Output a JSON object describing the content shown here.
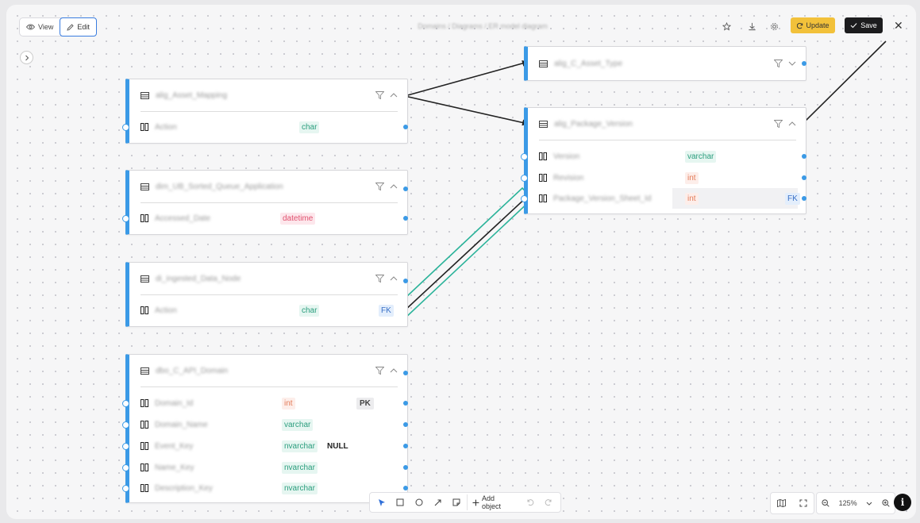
{
  "toolbar": {
    "view_label": "View",
    "edit_label": "Edit",
    "breadcrumb": "Domains / Diagrams / ER model diagram",
    "update_label": "Update",
    "save_label": "Save",
    "close_glyph": "✕"
  },
  "tables": [
    {
      "name": "alig_Asset_Mapping",
      "columns": [
        {
          "name": "Action",
          "type": "char"
        }
      ]
    },
    {
      "name": "dim_UB_Sorted_Queue_Application",
      "columns": [
        {
          "name": "Accessed_Date",
          "type": "datetime"
        }
      ]
    },
    {
      "name": "di_ingested_Data_Node",
      "columns": [
        {
          "name": "Action",
          "type": "char",
          "key": "FK"
        }
      ]
    },
    {
      "name": "dbo_C_API_Domain",
      "columns": [
        {
          "name": "Domain_Id",
          "type": "int",
          "key": "PK"
        },
        {
          "name": "Domain_Name",
          "type": "varchar"
        },
        {
          "name": "Event_Key",
          "type": "nvarchar",
          "nullable": "NULL"
        },
        {
          "name": "Name_Key",
          "type": "nvarchar"
        },
        {
          "name": "Description_Key",
          "type": "nvarchar"
        }
      ]
    },
    {
      "name": "alig_C_Asset_Type",
      "columns": []
    },
    {
      "name": "alig_Package_Version",
      "columns": [
        {
          "name": "Version",
          "type": "varchar"
        },
        {
          "name": "Revision",
          "type": "int"
        },
        {
          "name": "Package_Version_Sheet_Id",
          "type": "int",
          "key": "FK"
        }
      ]
    }
  ],
  "bottom_toolbar": {
    "add_object_label": "Add object",
    "tools": [
      "pointer-icon",
      "rectangle-icon",
      "circle-icon",
      "arrow-icon",
      "sticky-note-icon"
    ]
  },
  "zoom": {
    "level": "125%"
  },
  "info_glyph": "i",
  "colors": {
    "accent": "#3b9ae6",
    "update": "#f2c13a",
    "save": "#1c1c1e",
    "selection": "#2bb39a"
  }
}
